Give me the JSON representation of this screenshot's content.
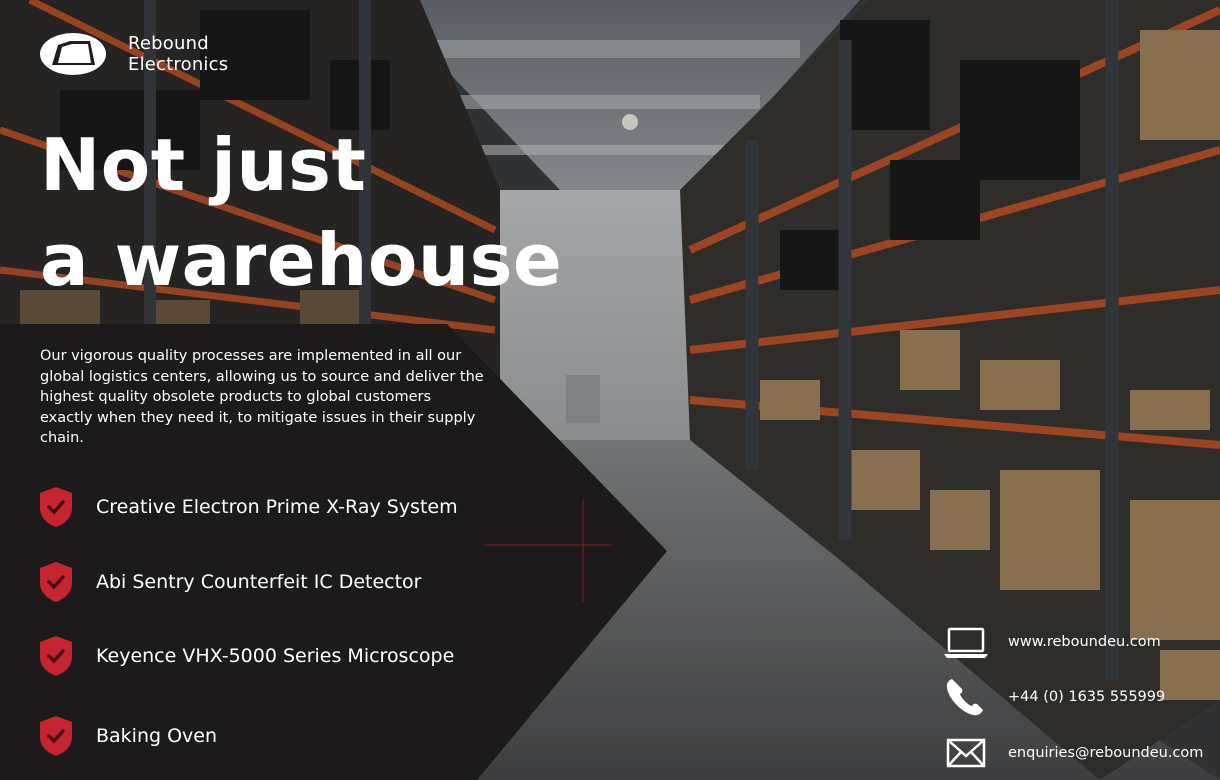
{
  "brand": {
    "logo_icon": "rebound-logo-mark",
    "name_line1": "Rebound",
    "name_line2": "Electronics"
  },
  "headline": {
    "line1": "Not just",
    "line2": "a warehouse"
  },
  "intro_text": "Our vigorous quality processes are implemented in all our global logistics centers, allowing us to source and deliver the highest quality obsolete products to global customers exactly when they need it, to mitigate issues in their supply chain.",
  "features": [
    {
      "icon": "shield-check-icon",
      "label": "Creative Electron Prime X-Ray System"
    },
    {
      "icon": "shield-check-icon",
      "label": "Abi Sentry Counterfeit IC Detector"
    },
    {
      "icon": "shield-check-icon",
      "label": "Keyence VHX-5000 Series Microscope"
    },
    {
      "icon": "shield-check-icon",
      "label": "Baking Oven"
    }
  ],
  "contacts": [
    {
      "icon": "laptop-icon",
      "text": "www.reboundeu.com"
    },
    {
      "icon": "phone-icon",
      "text": "+44 (0) 1635 555999"
    },
    {
      "icon": "envelope-icon",
      "text": "enquiries@reboundeu.com"
    }
  ],
  "colors": {
    "accent_red": "#c42530",
    "panel": "#1c1a1b",
    "shelf_orange": "#b94a26"
  }
}
